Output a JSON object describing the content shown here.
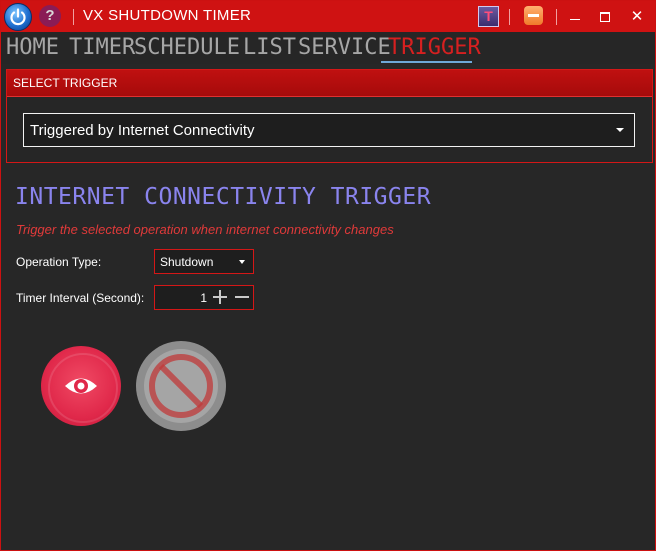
{
  "window": {
    "title": "VX SHUTDOWN TIMER",
    "help_glyph": "?",
    "t_glyph": "T",
    "close_glyph": "✕"
  },
  "nav": {
    "tabs": [
      {
        "label": "HOME"
      },
      {
        "label": "TIMER"
      },
      {
        "label": "SCHEDULE"
      },
      {
        "label": "LIST"
      },
      {
        "label": "SERVICE"
      },
      {
        "label": "TRIGGER"
      }
    ],
    "active_tab": "TRIGGER"
  },
  "select_trigger": {
    "header": "SELECT TRIGGER",
    "selected_value": "Triggered by Internet Connectivity"
  },
  "section": {
    "title": "INTERNET CONNECTIVITY TRIGGER",
    "subtitle": "Trigger the selected operation when internet connectivity changes"
  },
  "fields": {
    "operation_type_label": "Operation Type:",
    "operation_type_value": "Shutdown",
    "timer_interval_label": "Timer Interval (Second):",
    "timer_interval_value": "1"
  },
  "icons": {
    "power": "power-icon",
    "help": "help-icon",
    "eye": "eye-icon",
    "stop": "stop-icon"
  },
  "colors": {
    "title_bar": "#cf1212",
    "accent_red": "#d62020",
    "section_title": "#8a84ee",
    "subtitle": "#e03a3a",
    "eye_button": "#e0284a",
    "stop_button": "#a5a5a5"
  }
}
